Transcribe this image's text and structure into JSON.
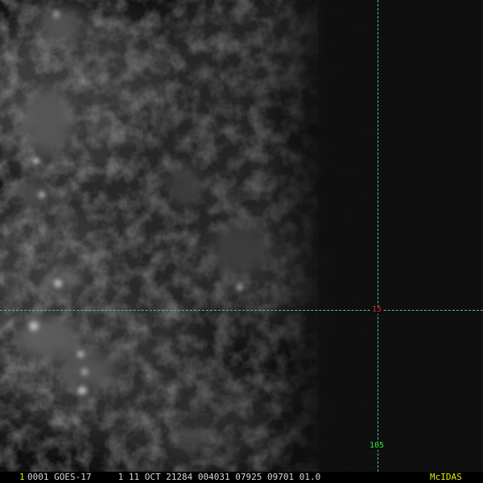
{
  "grid": {
    "latitude_label": "15",
    "longitude_label": "105",
    "line_color": "#39c6c6",
    "latitude_label_color": "#e23030",
    "longitude_label_color": "#3ce03c"
  },
  "status_bar": {
    "frame_number": "1",
    "text": "0001 GOES-17     1 11 OCT 21284 004031 07925 09701 01.0",
    "logo": "McIDAS",
    "accent_color": "#e8e800"
  }
}
